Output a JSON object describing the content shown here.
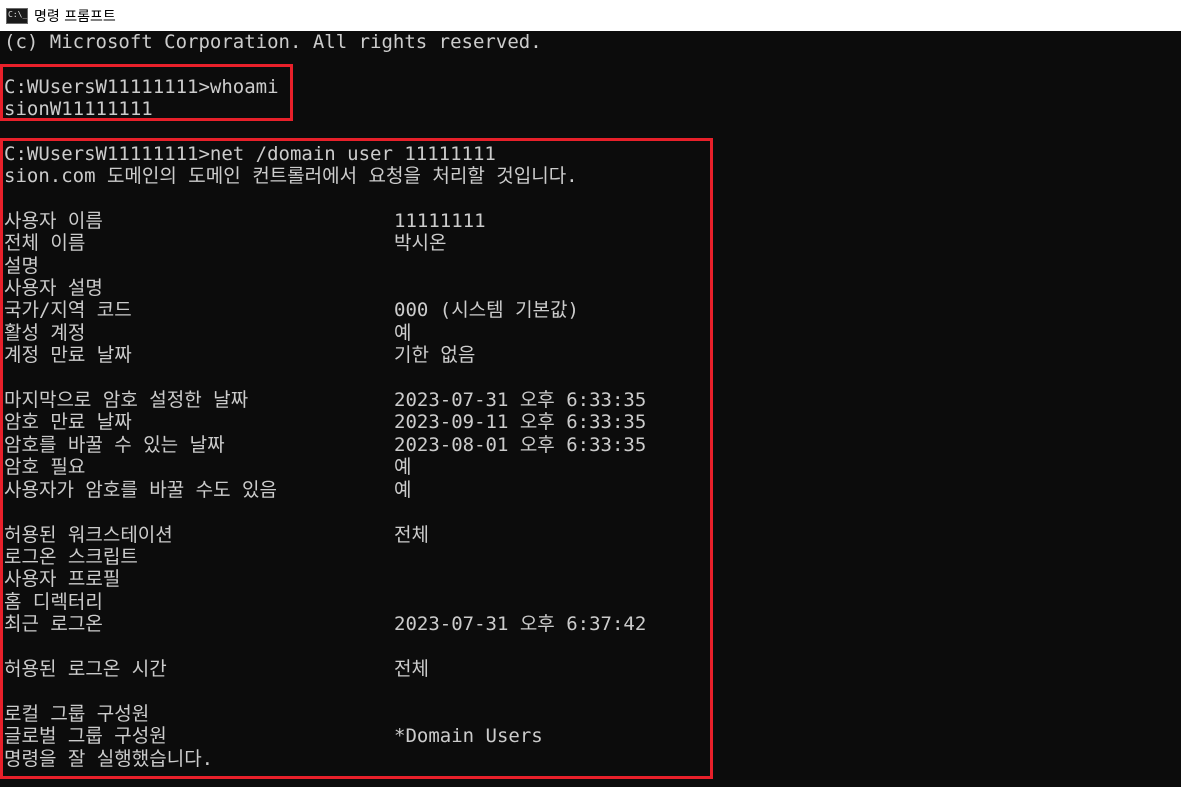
{
  "window": {
    "title": "명령 프롬프트"
  },
  "console": {
    "copyright": "(c) Microsoft Corporation. All rights reserved.",
    "whoami_cmd": "C:WUsersW11111111>whoami",
    "whoami_out": "sionW11111111",
    "net_cmd": "C:WUsersW11111111>net /domain user 11111111",
    "net_intro": "sion.com 도메인의 도메인 컨트롤러에서 요청을 처리할 것입니다.",
    "fields": [
      {
        "label": "사용자 이름",
        "value": "11111111"
      },
      {
        "label": "전체 이름",
        "value": "박시온"
      },
      {
        "label": "설명",
        "value": ""
      },
      {
        "label": "사용자 설명",
        "value": ""
      },
      {
        "label": "국가/지역 코드",
        "value": "000 (시스템 기본값)"
      },
      {
        "label": "활성 계정",
        "value": "예"
      },
      {
        "label": "계정 만료 날짜",
        "value": "기한 없음"
      },
      {
        "label": "마지막으로 암호 설정한 날짜",
        "value": "2023-07-31 오후 6:33:35"
      },
      {
        "label": "암호 만료 날짜",
        "value": "2023-09-11 오후 6:33:35"
      },
      {
        "label": "암호를 바꿀 수 있는 날짜",
        "value": "2023-08-01 오후 6:33:35"
      },
      {
        "label": "암호 필요",
        "value": "예"
      },
      {
        "label": "사용자가 암호를 바꿀 수도 있음",
        "value": "예"
      },
      {
        "label": "허용된 워크스테이션",
        "value": "전체"
      },
      {
        "label": "로그온 스크립트",
        "value": ""
      },
      {
        "label": "사용자 프로필",
        "value": ""
      },
      {
        "label": "홈 디렉터리",
        "value": ""
      },
      {
        "label": "최근 로그온",
        "value": "2023-07-31 오후 6:37:42"
      },
      {
        "label": "허용된 로그온 시간",
        "value": "전체"
      },
      {
        "label": "로컬 그룹 구성원",
        "value": ""
      },
      {
        "label": "글로벌 그룹 구성원",
        "value": "*Domain Users"
      }
    ],
    "completion": "명령을 잘 실행했습니다."
  },
  "colors": {
    "background": "#0c0c0c",
    "text": "#cccccc",
    "highlight": "#e8202a"
  },
  "icons": {
    "app": "cmd-icon"
  }
}
